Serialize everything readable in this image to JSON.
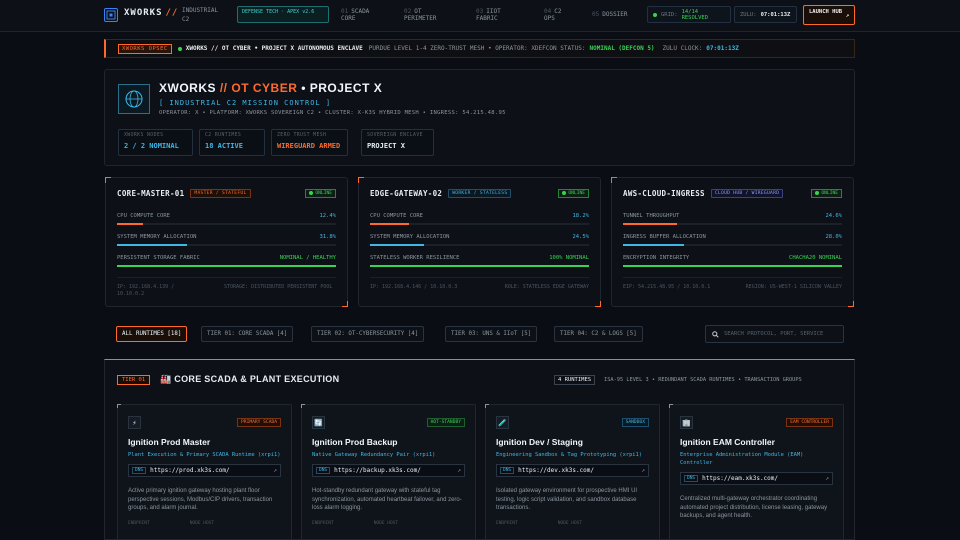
{
  "nav": {
    "brand": "XWORKS",
    "brand_sep": "//",
    "brand_sub": "INDUSTRIAL C2",
    "tech_pill": "DEFENSE TECH · APEX v2.6",
    "items": [
      {
        "num": "01",
        "label": "SCADA CORE"
      },
      {
        "num": "02",
        "label": "OT PERIMETER"
      },
      {
        "num": "03",
        "label": "IIOT FABRIC"
      },
      {
        "num": "04",
        "label": "C2 OPS"
      },
      {
        "num": "05",
        "label": "DOSSIER"
      }
    ],
    "grid_label": "GRID:",
    "grid_value": "14/14 RESOLVED",
    "zulu_label": "ZULU:",
    "zulu_value": "07:01:13Z",
    "launch_label": "LAUNCH HUB",
    "launch_arrow": "↗"
  },
  "banner": {
    "tag": "XWORKS OPSEC",
    "headline": "XWORKS // OT CYBER • PROJECT X AUTONOMOUS ENCLAVE",
    "detail": "PURDUE LEVEL 1-4 ZERO-TRUST MESH • OPERATOR: XDEFCON STATUS:",
    "status": "NOMINAL (DEFCON 5)",
    "clock_label": "ZULU CLOCK:",
    "clock": "07:01:13Z"
  },
  "header": {
    "title_a": "XWORKS",
    "title_sep": "//",
    "title_b": "OT CYBER",
    "title_c": "• PROJECT X",
    "subtitle": "[ INDUSTRIAL C2 MISSION CONTROL ]",
    "meta": "OPERATOR: X • PLATFORM: XWORKS SOVEREIGN C2 • CLUSTER: X-K3S HYBRID MESH • INGRESS: 54.215.48.95",
    "stats": [
      {
        "label": "XWORKS NODES",
        "value": "2 / 2 NOMINAL",
        "color": "#3fb6e6"
      },
      {
        "label": "C2 RUNTIMES",
        "value": "18 ACTIVE",
        "color": "#3fb6e6"
      },
      {
        "label": "ZERO TRUST MESH",
        "value": "WIREGUARD ARMED",
        "color": "#ff6a2b"
      },
      {
        "label": "SOVEREIGN ENCLAVE",
        "value": "PROJECT X",
        "color": "#e6edf3"
      }
    ]
  },
  "nodes": [
    {
      "name": "CORE-MASTER-01",
      "role": "MASTER / STATEFUL",
      "role_color": "#ff6a2b",
      "status": "ONLINE",
      "metrics": [
        {
          "label": "CPU COMPUTE CORE",
          "value": "12.4%",
          "fill": 0.12,
          "color": "#ff6a2b"
        },
        {
          "label": "SYSTEM MEMORY ALLOCATION",
          "value": "31.8%",
          "fill": 0.32,
          "color": "#3fb6e6"
        },
        {
          "label": "PERSISTENT STORAGE FABRIC",
          "value": "NOMINAL / HEALTHY",
          "fill": 1.0,
          "color": "#39d353"
        }
      ],
      "foot_left": "IP: 192.168.4.139 / 10.10.0.2",
      "foot_right": "STORAGE: DISTRIBUTED PERSISTENT POOL"
    },
    {
      "name": "EDGE-GATEWAY-02",
      "role": "WORKER / STATELESS",
      "role_color": "#3fb6e6",
      "status": "ONLINE",
      "metrics": [
        {
          "label": "CPU COMPUTE CORE",
          "value": "18.2%",
          "fill": 0.18,
          "color": "#ff6a2b"
        },
        {
          "label": "SYSTEM MEMORY ALLOCATION",
          "value": "24.5%",
          "fill": 0.245,
          "color": "#3fb6e6"
        },
        {
          "label": "STATELESS WORKER RESILIENCE",
          "value": "100% NOMINAL",
          "fill": 1.0,
          "color": "#39d353"
        }
      ],
      "foot_left": "IP: 192.168.4.146 / 10.10.0.3",
      "foot_right": "ROLE: STATELESS EDGE GATEWAY"
    },
    {
      "name": "AWS-CLOUD-INGRESS",
      "role": "CLOUD HUB / WIREGUARD",
      "role_color": "#8b9cf6",
      "status": "ONLINE",
      "metrics": [
        {
          "label": "TUNNEL THROUGHPUT",
          "value": "24.6%",
          "fill": 0.246,
          "color": "#ff6a2b"
        },
        {
          "label": "INGRESS BUFFER ALLOCATION",
          "value": "28.0%",
          "fill": 0.28,
          "color": "#3fb6e6"
        },
        {
          "label": "ENCRYPTION INTEGRITY",
          "value": "CHACHA20 NOMINAL",
          "fill": 1.0,
          "color": "#39d353"
        }
      ],
      "foot_left": "EIP: 54.215.48.95 / 10.10.0.1",
      "foot_right": "REGION: US-WEST-1 SILICON VALLEY"
    }
  ],
  "filters": [
    "ALL RUNTIMES [18]",
    "TIER 01: CORE SCADA [4]",
    "TIER 02: OT-CYBERSECURITY [4]",
    "TIER 03: UNS & IIoT [5]",
    "TIER 04: C2 & LOGS [5]"
  ],
  "search_placeholder": "SEARCH PROTOCOL, PORT, SERVICE",
  "tier": {
    "tag": "TIER 01",
    "title": "🏭 CORE SCADA & PLANT EXECUTION",
    "count": "4 RUNTIMES",
    "desc": "ISA-95 LEVEL 3 • REDUNDANT SCADA RUNTIMES • TRANSACTION GROUPS"
  },
  "services": [
    {
      "icon": "⚡",
      "badge": "PRIMARY SCADA",
      "badge_color": "#ff6a2b",
      "name": "Ignition Prod Master",
      "role": "Plant Execution & Primary SCADA Runtime (xrpi1)",
      "dns_tag": "DNS",
      "url": "https://prod.xk3s.com/",
      "desc": "Active primary ignition gateway hosting plant floor perspective sessions, Modbus/CIP drivers, transaction groups, and alarm journal.",
      "foot_a": "ENDPOINT",
      "foot_b": "NODE HOST"
    },
    {
      "icon": "🔄",
      "badge": "HOT-STANDBY",
      "badge_color": "#39d353",
      "name": "Ignition Prod Backup",
      "role": "Native Gateway Redundancy Pair (xrpi1)",
      "dns_tag": "DNS",
      "url": "https://backup.xk3s.com/",
      "desc": "Hot-standby redundant gateway with stateful tag synchronization, automated heartbeat failover, and zero-loss alarm logging.",
      "foot_a": "ENDPOINT",
      "foot_b": "NODE HOST"
    },
    {
      "icon": "🧪",
      "badge": "SANDBOX",
      "badge_color": "#3fb6e6",
      "name": "Ignition Dev / Staging",
      "role": "Engineering Sandbox & Tag Prototyping (xrpi1)",
      "dns_tag": "DNS",
      "url": "https://dev.xk3s.com/",
      "desc": "Isolated gateway environment for prospective HMI UI testing, logic script validation, and sandbox database transactions.",
      "foot_a": "ENDPOINT",
      "foot_b": "NODE HOST"
    },
    {
      "icon": "🏢",
      "badge": "EAM CONTROLLER",
      "badge_color": "#ff6a2b",
      "name": "Ignition EAM Controller",
      "role": "Enterprise Administration Module (EAM) Controller",
      "dns_tag": "DNS",
      "url": "https://eam.xk3s.com/",
      "desc": "Centralized multi-gateway orchestrator coordinating automated project distribution, license leasing, gateway backups, and agent health.",
      "foot_a": "",
      "foot_b": ""
    }
  ]
}
